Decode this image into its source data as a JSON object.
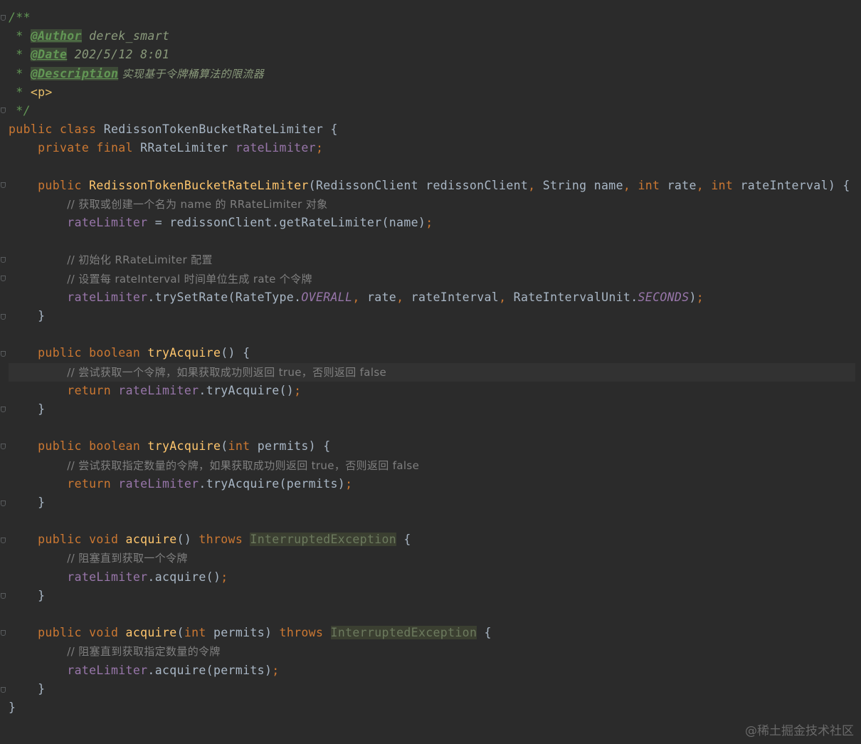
{
  "editor": {
    "theme": "darcula",
    "background": "#2b2b2b",
    "colors": {
      "keyword": "#cc7832",
      "doc_comment": "#629755",
      "comment": "#808080",
      "method": "#ffc66d",
      "field": "#9876aa",
      "text": "#a9b7c6"
    }
  },
  "code": {
    "l1": "/**",
    "l2_prefix": " * ",
    "l2_tag": "@Author",
    "l2_value": " derek_smart",
    "l3_prefix": " * ",
    "l3_tag": "@Date",
    "l3_value": " 202/5/12 8:01",
    "l4_prefix": " * ",
    "l4_tag": "@Description",
    "l4_value": " 实现基于令牌桶算法的限流器",
    "l5_prefix": " * ",
    "l5_html": "<p>",
    "l6": " */",
    "l7_kw1": "public",
    "l7_kw2": " class",
    "l7_rest": " RedissonTokenBucketRateLimiter {",
    "l8_indent": "    ",
    "l8_kw1": "private",
    "l8_kw2": " final",
    "l8_type": " RRateLimiter ",
    "l8_field": "rateLimiter",
    "l8_semi": ";",
    "l9": "",
    "l10_indent": "    ",
    "l10_kw": "public",
    "l10_fn": " RedissonTokenBucketRateLimiter",
    "l10_a": "(RedissonClient redissonClient",
    "l10_c1": ",",
    "l10_b": " String name",
    "l10_c2": ",",
    "l10_kwint1": " int",
    "l10_c": " rate",
    "l10_c3": ",",
    "l10_kwint2": " int",
    "l10_d": " rateInterval) {",
    "l11_indent": "        ",
    "l11_cmt": "// 获取或创建一个名为 name 的 RRateLimiter 对象",
    "l12_indent": "        ",
    "l12_field": "rateLimiter",
    "l12_rest": " = redissonClient.getRateLimiter(name)",
    "l12_semi": ";",
    "l13": "",
    "l14_indent": "        ",
    "l14_cmt": "// 初始化 RRateLimiter 配置",
    "l15_indent": "        ",
    "l15_cmt": "// 设置每 rateInterval 时间单位生成 rate 个令牌",
    "l16_indent": "        ",
    "l16_field": "rateLimiter",
    "l16_a": ".trySetRate(RateType.",
    "l16_const1": "OVERALL",
    "l16_c1": ",",
    "l16_b": " rate",
    "l16_c2": ",",
    "l16_c": " rateInterval",
    "l16_c3": ",",
    "l16_d": " RateIntervalUnit.",
    "l16_const2": "SECONDS",
    "l16_e": ")",
    "l16_semi": ";",
    "l17": "    }",
    "l18": "",
    "l19_indent": "    ",
    "l19_kw1": "public",
    "l19_kw2": " boolean",
    "l19_fn": " tryAcquire",
    "l19_rest": "() {",
    "l20_indent": "        ",
    "l20_cmt": "// 尝试获取一个令牌，如果获取成功则返回 true，否则返回 false",
    "l21_indent": "        ",
    "l21_kw": "return",
    "l21_sp": " ",
    "l21_field": "rateLimiter",
    "l21_rest": ".tryAcquire()",
    "l21_semi": ";",
    "l22": "    }",
    "l23": "",
    "l24_indent": "    ",
    "l24_kw1": "public",
    "l24_kw2": " boolean",
    "l24_fn": " tryAcquire",
    "l24_a": "(",
    "l24_kwint": "int",
    "l24_rest": " permits) {",
    "l25_indent": "        ",
    "l25_cmt": "// 尝试获取指定数量的令牌，如果获取成功则返回 true，否则返回 false",
    "l26_indent": "        ",
    "l26_kw": "return",
    "l26_sp": " ",
    "l26_field": "rateLimiter",
    "l26_rest": ".tryAcquire(permits)",
    "l26_semi": ";",
    "l27": "    }",
    "l28": "",
    "l29_indent": "    ",
    "l29_kw1": "public",
    "l29_kw2": " void",
    "l29_fn": " acquire",
    "l29_a": "() ",
    "l29_kw3": "throws",
    "l29_sp": " ",
    "l29_exc": "InterruptedException",
    "l29_rest": " {",
    "l30_indent": "        ",
    "l30_cmt": "// 阻塞直到获取一个令牌",
    "l31_indent": "        ",
    "l31_field": "rateLimiter",
    "l31_rest": ".acquire()",
    "l31_semi": ";",
    "l32": "    }",
    "l33": "",
    "l34_indent": "    ",
    "l34_kw1": "public",
    "l34_kw2": " void",
    "l34_fn": " acquire",
    "l34_a": "(",
    "l34_kwint": "int",
    "l34_b": " permits) ",
    "l34_kw3": "throws",
    "l34_sp": " ",
    "l34_exc": "InterruptedException",
    "l34_rest": " {",
    "l35_indent": "        ",
    "l35_cmt": "// 阻塞直到获取指定数量的令牌",
    "l36_indent": "        ",
    "l36_field": "rateLimiter",
    "l36_rest": ".acquire(permits)",
    "l36_semi": ";",
    "l37": "    }",
    "l38": "}"
  },
  "watermark": "@稀土掘金技术社区"
}
